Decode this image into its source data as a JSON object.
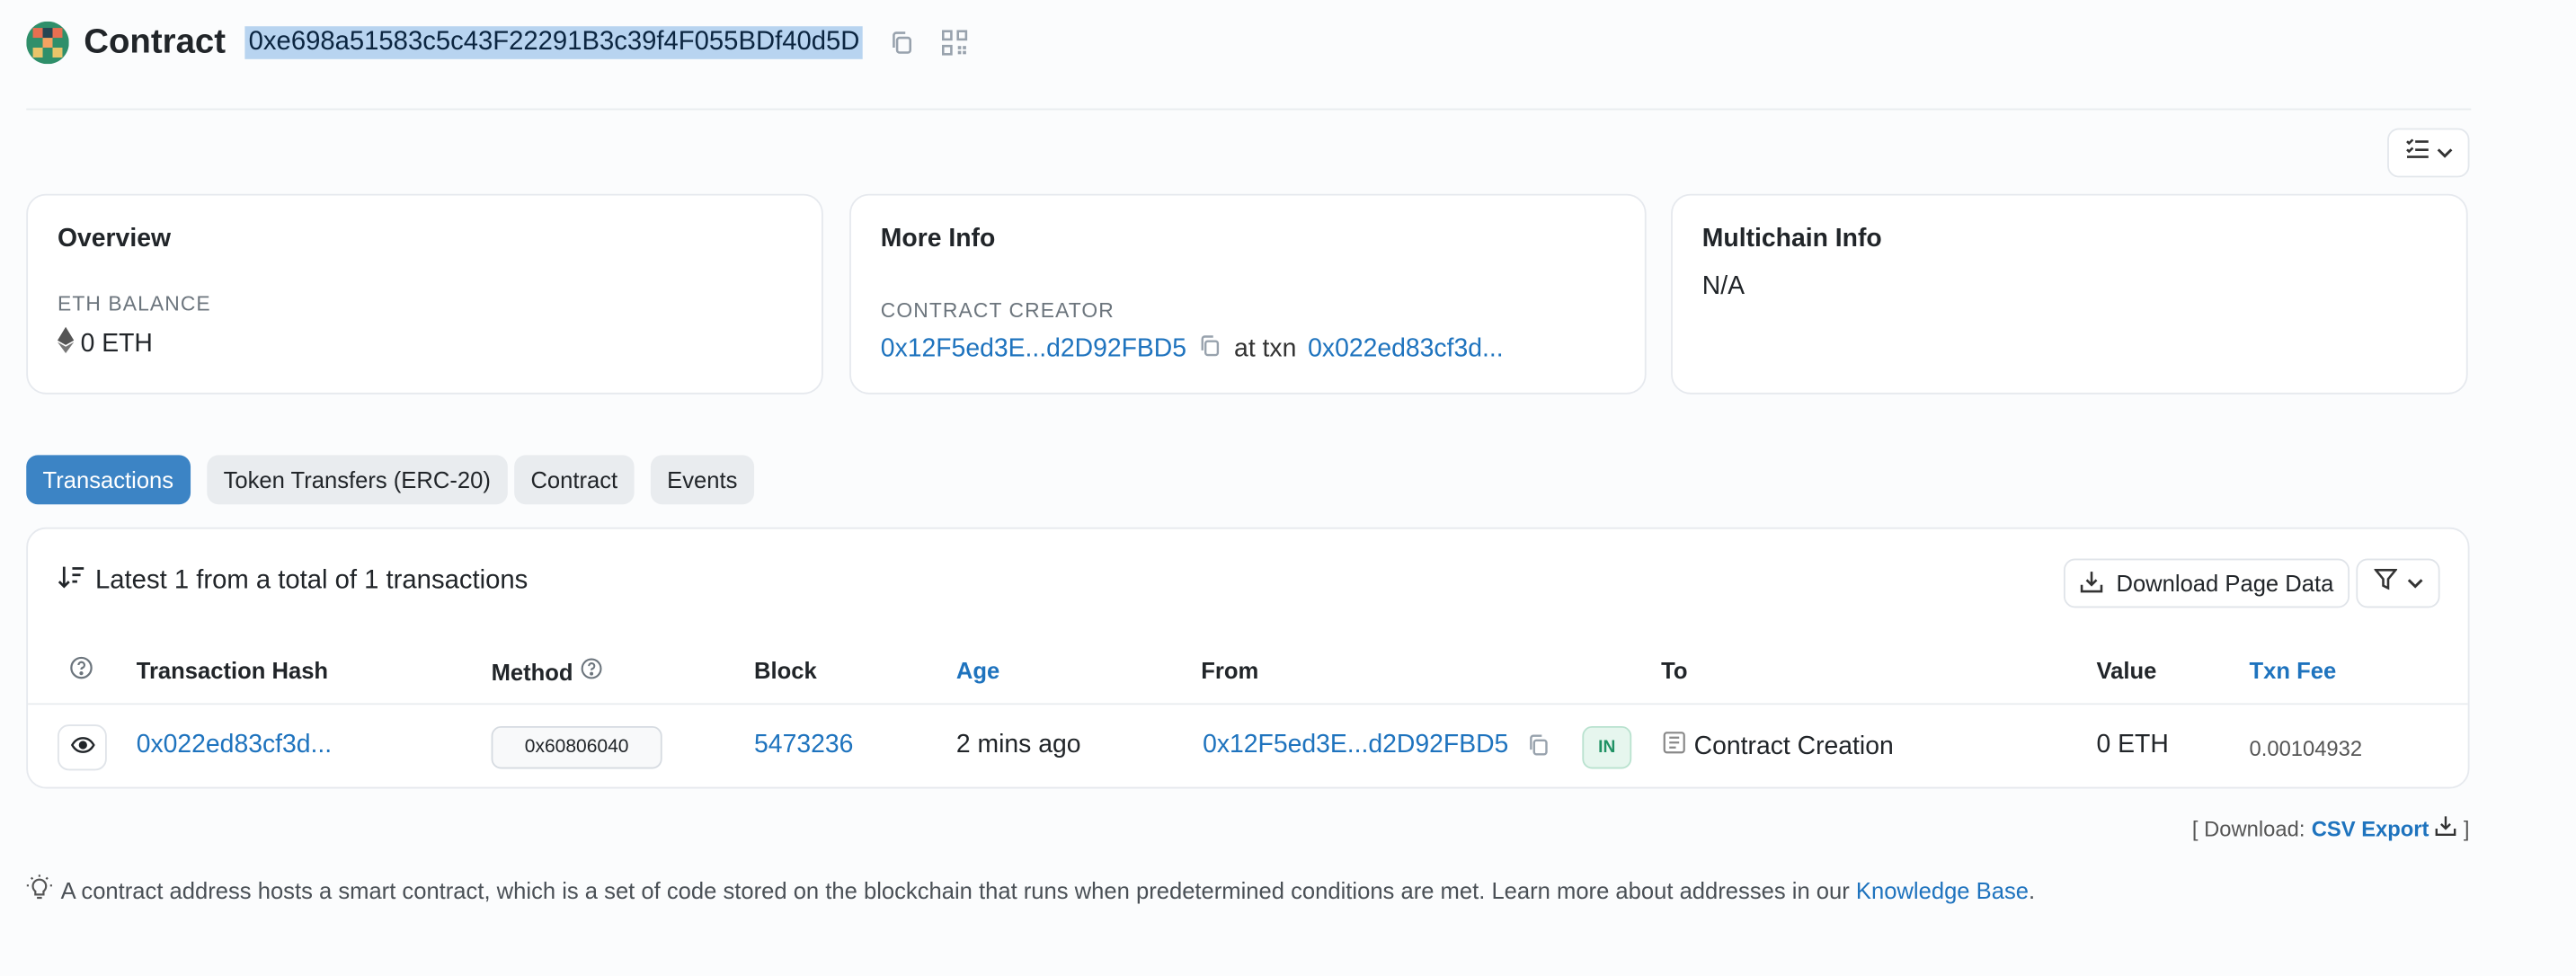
{
  "header": {
    "title": "Contract",
    "address": "0xe698a51583c5c43F22291B3c39f4F055BDf40d5D",
    "icons": [
      "avatar-identicon",
      "copy-icon",
      "qr-code-icon"
    ]
  },
  "view_button": {
    "icons": [
      "list-check-icon",
      "chevron-down-icon"
    ]
  },
  "overview": {
    "title": "Overview",
    "balance_label": "ETH BALANCE",
    "balance_value": "0 ETH"
  },
  "more_info": {
    "title": "More Info",
    "creator_label": "CONTRACT CREATOR",
    "creator_address": "0x12F5ed3E...d2D92FBD5",
    "at_txn": "at txn",
    "txn_hash": "0x022ed83cf3d..."
  },
  "multichain": {
    "title": "Multichain Info",
    "value": "N/A"
  },
  "tabs": [
    {
      "label": "Transactions",
      "active": true
    },
    {
      "label": "Token Transfers (ERC-20)"
    },
    {
      "label": "Contract"
    },
    {
      "label": "Events"
    }
  ],
  "transactions": {
    "summary": "Latest 1 from a total of 1 transactions",
    "download_label": "Download Page Data",
    "columns": [
      "Transaction Hash",
      "Method",
      "Block",
      "Age",
      "From",
      "To",
      "Value",
      "Txn Fee"
    ],
    "rows": [
      {
        "hash": "0x022ed83cf3d...",
        "method": "0x60806040",
        "block": "5473236",
        "age": "2 mins ago",
        "from": "0x12F5ed3E...d2D92FBD5",
        "direction": "IN",
        "to": "Contract Creation",
        "value": "0 ETH",
        "fee": "0.00104932"
      }
    ]
  },
  "csv": {
    "prefix": "[ Download:",
    "link": "CSV Export",
    "suffix": "]"
  },
  "footer": {
    "text": "A contract address hosts a smart contract, which is a set of code stored on the blockchain that runs when predetermined conditions are met. Learn more about addresses in our",
    "link": "Knowledge Base",
    "end": "."
  },
  "colors": {
    "link": "#1e73be",
    "active_tab": "#3c84c5",
    "in_badge": "#1f9264"
  }
}
